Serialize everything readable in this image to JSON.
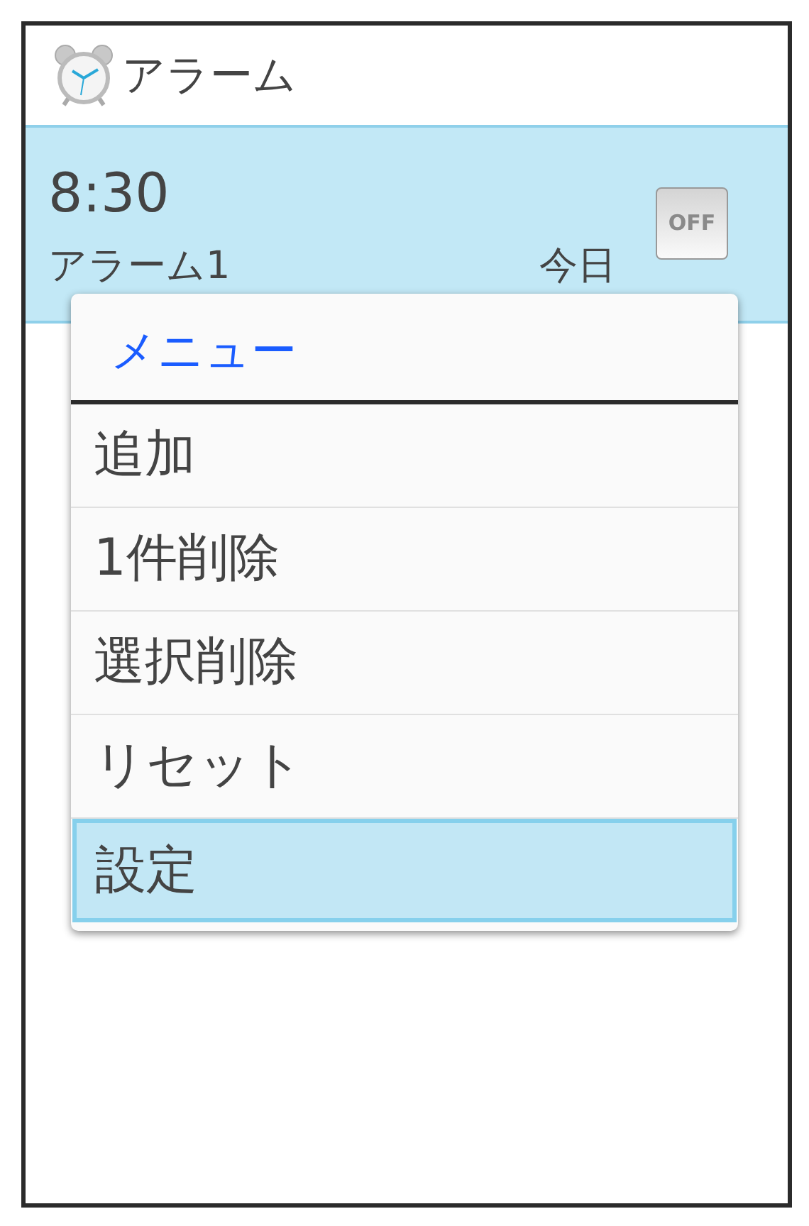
{
  "app_bar": {
    "title": "アラーム"
  },
  "alarms": [
    {
      "time": "8:30",
      "name": "アラーム1",
      "day": "今日",
      "switch": {
        "label": "OFF",
        "on": false
      },
      "selected": true
    }
  ],
  "menu": {
    "title": "メニュー",
    "items": [
      {
        "label": "追加",
        "selected": false
      },
      {
        "label": "1件削除",
        "selected": false
      },
      {
        "label": "選択削除",
        "selected": false
      },
      {
        "label": "リセット",
        "selected": false
      },
      {
        "label": "設定",
        "selected": true
      }
    ]
  }
}
